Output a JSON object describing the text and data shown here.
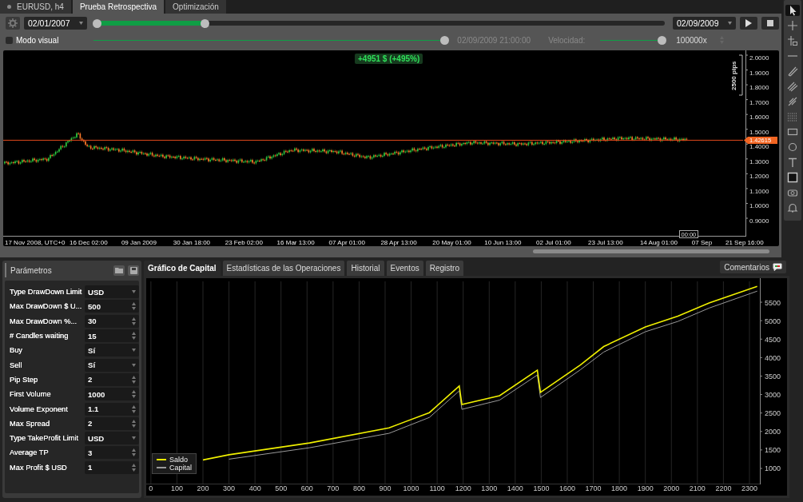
{
  "tabs": [
    {
      "label": "EURUSD, h4",
      "selected": false,
      "kind": "symbol"
    },
    {
      "label": "Prueba Retrospectiva",
      "selected": true,
      "kind": "plain"
    },
    {
      "label": "Optimización",
      "selected": false,
      "kind": "plain"
    }
  ],
  "backtest": {
    "start_date": "02/01/2007",
    "end_date": "02/09/2009",
    "range_slider": {
      "level": 0.19
    },
    "visual_mode": {
      "label": "Modo visual",
      "checked": false
    },
    "progress_slider": {
      "level": 1
    },
    "current_time": "02/09/2009 21:00:00",
    "speed_label": "Velocidad:",
    "speed_slider": {
      "level": 1
    },
    "speed_value": "100000x"
  },
  "price_chart": {
    "badge": "+4951 $ (+495%)",
    "scale_label": "2500 pips",
    "price_tag": "1.42615",
    "time_tag": "00:00",
    "y_labels": [
      "2.0000",
      "1.9000",
      "1.8000",
      "1.7000",
      "1.6000",
      "1.5000",
      "1.4000",
      "1.3000",
      "1.2000",
      "1.1000",
      "1.0000",
      "0.9000"
    ],
    "x_labels": [
      "17 Nov 2008, UTC+0",
      "16 Dec 02:00",
      "09 Jan 2009",
      "30 Jan 18:00",
      "23 Feb 02:00",
      "16 Mar 13:00",
      "07 Apr 01:00",
      "28 Apr 13:00",
      "20 May 01:00",
      "10 Jun 13:00",
      "02 Jul 01:00",
      "23 Jul 13:00",
      "14 Aug 01:00",
      "07 Sep",
      "21 Sep 16:00"
    ]
  },
  "parameters": {
    "title": "Parámetros",
    "items": [
      {
        "label": "Type DrawDown Limit",
        "value": "USD",
        "kind": "select"
      },
      {
        "label": "Max DrawDown $ U...",
        "value": "500",
        "kind": "spinner"
      },
      {
        "label": "Max DrawDown %...",
        "value": "30",
        "kind": "spinner"
      },
      {
        "label": "# Candles waiting",
        "value": "15",
        "kind": "spinner"
      },
      {
        "label": "Buy",
        "value": "Sí",
        "kind": "select"
      },
      {
        "label": "Sell",
        "value": "Sí",
        "kind": "select"
      },
      {
        "label": "Pip Step",
        "value": "2",
        "kind": "spinner"
      },
      {
        "label": "First Volume",
        "value": "1000",
        "kind": "spinner"
      },
      {
        "label": "Volume Exponent",
        "value": "1.1",
        "kind": "spinner"
      },
      {
        "label": "Max Spread",
        "value": "2",
        "kind": "spinner"
      },
      {
        "label": "Type TakeProfit Limit",
        "value": "USD",
        "kind": "select"
      },
      {
        "label": "Average TP",
        "value": "3",
        "kind": "spinner"
      },
      {
        "label": "Max Profit $ USD",
        "value": "1",
        "kind": "spinner"
      }
    ]
  },
  "result_tabs": [
    {
      "label": "Gráfico de Capital",
      "selected": true
    },
    {
      "label": "Estadísticas de las Operaciones",
      "selected": false
    },
    {
      "label": "Historial",
      "selected": false
    },
    {
      "label": "Eventos",
      "selected": false
    },
    {
      "label": "Registro",
      "selected": false
    }
  ],
  "comments_button": "Comentarios",
  "equity_chart": {
    "chart_data": {
      "type": "line",
      "grid": true,
      "legend": "lower left",
      "xlim": [
        -18,
        2340
      ],
      "ylim": [
        567,
        6150
      ],
      "xticks": [
        0,
        100,
        200,
        300,
        400,
        500,
        600,
        700,
        800,
        900,
        1000,
        1100,
        1200,
        1300,
        1400,
        1500,
        1600,
        1700,
        1800,
        1900,
        2000,
        2100,
        2200,
        2300
      ],
      "yticks": [
        1000,
        1500,
        2000,
        2500,
        3000,
        3500,
        4000,
        4500,
        5000,
        5500
      ],
      "x": [
        200,
        300,
        610,
        915,
        1070,
        1185,
        1195,
        1340,
        1485,
        1497,
        1650,
        1740,
        1900,
        2025,
        2145,
        2330
      ],
      "series": [
        {
          "name": "Saldo",
          "color": "#f0f000",
          "values": [
            1230,
            1370,
            1690,
            2100,
            2510,
            3230,
            2730,
            2970,
            3660,
            3060,
            3800,
            4300,
            4830,
            5120,
            5480,
            5930
          ]
        },
        {
          "name": "Capital",
          "color": "#9a9a9a",
          "values": [
            null,
            1250,
            1560,
            1950,
            2380,
            3100,
            2600,
            2850,
            3530,
            2920,
            3670,
            4150,
            4700,
            4980,
            5340,
            5800
          ]
        }
      ]
    }
  }
}
